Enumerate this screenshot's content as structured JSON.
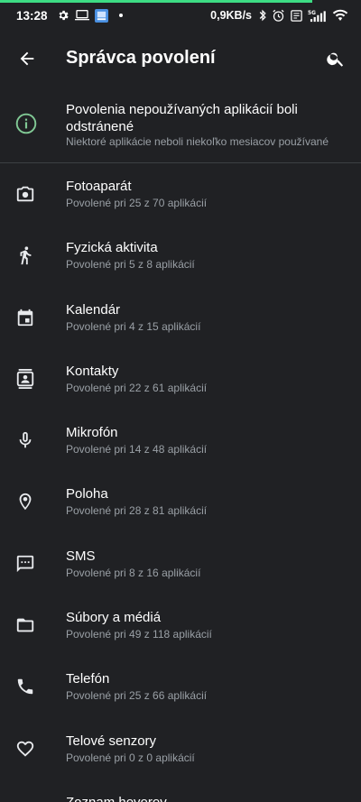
{
  "status_bar": {
    "time": "13:28",
    "speed": "0,9KB/s",
    "left_icons": [
      "gear-icon",
      "laptop-icon",
      "app-notification-icon"
    ],
    "right_icons": [
      "bluetooth-icon",
      "alarm-icon",
      "vibrate-off-icon",
      "signal-5g-icon",
      "wifi-icon",
      "battery-icon"
    ],
    "accent_color": "#3ddc84"
  },
  "appbar": {
    "title": "Správca povolení",
    "back_icon": "arrow-back-icon",
    "search_icon": "search-icon"
  },
  "notice": {
    "icon": "info-icon",
    "title": "Povolenia nepoužívaných aplikácií boli odstránené",
    "subtitle": "Niektoré aplikácie neboli niekoľko mesiacov používané",
    "icon_color": "#81c995"
  },
  "permissions": [
    {
      "label": "Fotoaparát",
      "subtitle": "Povolené pri 25 z 70 aplikácií",
      "icon": "camera-icon"
    },
    {
      "label": "Fyzická aktivita",
      "subtitle": "Povolené pri 5 z 8 aplikácií",
      "icon": "walking-icon"
    },
    {
      "label": "Kalendár",
      "subtitle": "Povolené pri 4 z 15 aplikácií",
      "icon": "calendar-icon"
    },
    {
      "label": "Kontakty",
      "subtitle": "Povolené pri 22 z 61 aplikácií",
      "icon": "contacts-icon"
    },
    {
      "label": "Mikrofón",
      "subtitle": "Povolené pri 14 z 48 aplikácií",
      "icon": "microphone-icon"
    },
    {
      "label": "Poloha",
      "subtitle": "Povolené pri 28 z 81 aplikácií",
      "icon": "location-pin-icon"
    },
    {
      "label": "SMS",
      "subtitle": "Povolené pri 8 z 16 aplikácií",
      "icon": "sms-icon"
    },
    {
      "label": "Súbory a médiá",
      "subtitle": "Povolené pri 49 z 118 aplikácií",
      "icon": "folder-icon"
    },
    {
      "label": "Telefón",
      "subtitle": "Povolené pri 25 z 66 aplikácií",
      "icon": "phone-icon"
    },
    {
      "label": "Telové senzory",
      "subtitle": "Povolené pri 0 z 0 aplikácií",
      "icon": "heart-icon"
    },
    {
      "label": "Zoznam hovorov",
      "subtitle": "",
      "icon": "call-log-icon"
    }
  ]
}
